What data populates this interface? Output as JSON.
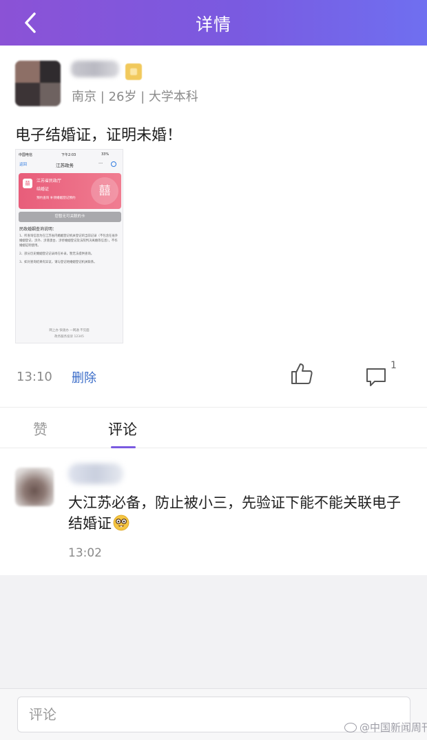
{
  "nav": {
    "title": "详情",
    "back_icon": "chevron-left-icon"
  },
  "post": {
    "meta": "南京 | 26岁 | 大学本科",
    "text": "电子结婚证，证明未婚！",
    "time": "13:10",
    "delete_label": "删除",
    "comment_count": "1",
    "screenshot": {
      "carrier": "中国电信",
      "clock": "下午2:03",
      "battery": "33%",
      "back": "返回",
      "title": "江苏政务",
      "more": "···",
      "card_line1": "江苏省民政厅",
      "card_line2": "结婚证",
      "card_links": "预约查询   补领婚姻登记预约",
      "card_icon": "囍",
      "no_card": "您暂无可关联的卡",
      "section_title": "民政婚姻查询说明：",
      "notes": [
        "1、所查询信息为在江苏省内婚姻登记机关登记的当前记录（不包含在省外婚姻登记、涉外、涉港澳台、涉侨婚姻登记及法院判决离婚等信息），不作婚姻证明使用。",
        "2、部分历史婚姻登记记录尚在补录，暂无法提供查询。",
        "3、如对查询结果有异议，请与登记地婚姻登记机关联系。"
      ],
      "footer1": "网上办 快速办 一网通 不见面",
      "footer2": "政务服务投诉 12345"
    }
  },
  "tabs": {
    "like": "赞",
    "comment": "评论"
  },
  "comments": [
    {
      "text": "大江苏必备，防止被小三，先验证下能不能关联电子结婚证",
      "time": "13:02",
      "emoji": "nerd-face-emoji"
    }
  ],
  "bottom": {
    "placeholder": "评论"
  },
  "watermark": "@中国新闻周刊",
  "colors": {
    "nav_start": "#8b52d6",
    "nav_end": "#6f6ff0",
    "accent": "#7a5ae0",
    "link": "#3a6cc8"
  }
}
